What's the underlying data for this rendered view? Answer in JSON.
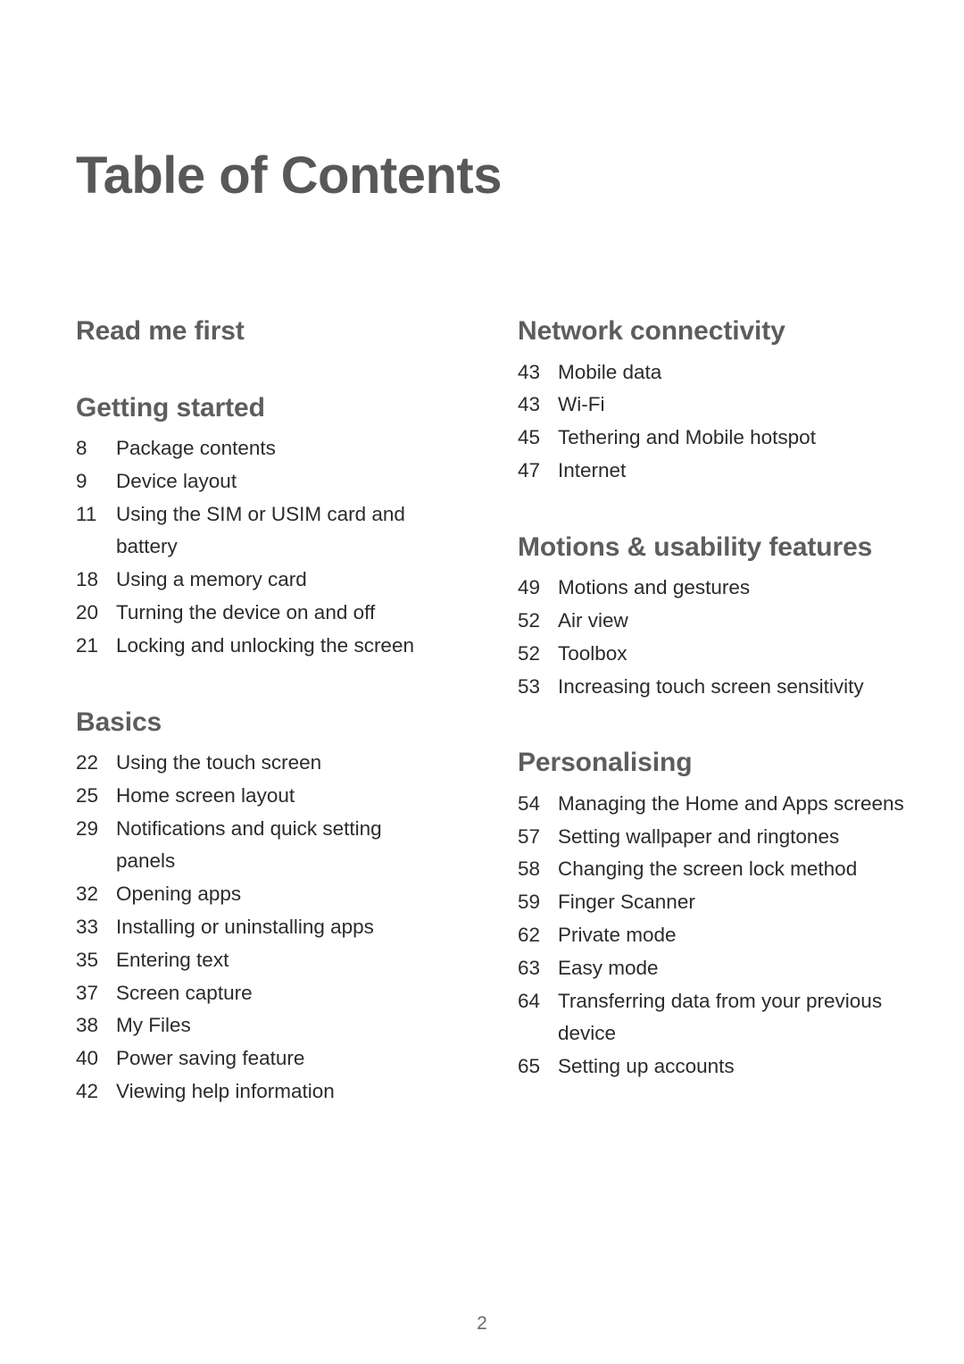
{
  "document": {
    "title": "Table of Contents",
    "page_number": "2",
    "colors": {
      "title": "#58585b",
      "heading": "#5d5d60",
      "body_text": "#2c2b2c",
      "page_number": "#6a6a6d",
      "background": "#ffffff"
    }
  },
  "columns": {
    "left": {
      "sections": [
        {
          "heading": "Read me first",
          "entries": []
        },
        {
          "heading": "Getting started",
          "entries": [
            {
              "page": "8",
              "title": "Package contents"
            },
            {
              "page": "9",
              "title": "Device layout"
            },
            {
              "page": "11",
              "title": "Using the SIM or USIM card and battery"
            },
            {
              "page": "18",
              "title": "Using a memory card"
            },
            {
              "page": "20",
              "title": "Turning the device on and off"
            },
            {
              "page": "21",
              "title": "Locking and unlocking the screen"
            }
          ]
        },
        {
          "heading": "Basics",
          "entries": [
            {
              "page": "22",
              "title": "Using the touch screen"
            },
            {
              "page": "25",
              "title": "Home screen layout"
            },
            {
              "page": "29",
              "title": "Notifications and quick setting panels"
            },
            {
              "page": "32",
              "title": "Opening apps"
            },
            {
              "page": "33",
              "title": "Installing or uninstalling apps"
            },
            {
              "page": "35",
              "title": "Entering text"
            },
            {
              "page": "37",
              "title": "Screen capture"
            },
            {
              "page": "38",
              "title": "My Files"
            },
            {
              "page": "40",
              "title": "Power saving feature"
            },
            {
              "page": "42",
              "title": "Viewing help information"
            }
          ]
        }
      ]
    },
    "right": {
      "sections": [
        {
          "heading": "Network connectivity",
          "entries": [
            {
              "page": "43",
              "title": "Mobile data"
            },
            {
              "page": "43",
              "title": "Wi-Fi"
            },
            {
              "page": "45",
              "title": "Tethering and Mobile hotspot"
            },
            {
              "page": "47",
              "title": "Internet"
            }
          ]
        },
        {
          "heading": "Motions & usability features",
          "entries": [
            {
              "page": "49",
              "title": "Motions and gestures"
            },
            {
              "page": "52",
              "title": "Air view"
            },
            {
              "page": "52",
              "title": "Toolbox"
            },
            {
              "page": "53",
              "title": "Increasing touch screen sensitivity"
            }
          ]
        },
        {
          "heading": "Personalising",
          "entries": [
            {
              "page": "54",
              "title": "Managing the Home and Apps screens"
            },
            {
              "page": "57",
              "title": "Setting wallpaper and ringtones"
            },
            {
              "page": "58",
              "title": "Changing the screen lock method"
            },
            {
              "page": "59",
              "title": "Finger Scanner"
            },
            {
              "page": "62",
              "title": "Private mode"
            },
            {
              "page": "63",
              "title": "Easy mode"
            },
            {
              "page": "64",
              "title": "Transferring data from your previous device"
            },
            {
              "page": "65",
              "title": "Setting up accounts"
            }
          ]
        }
      ]
    }
  }
}
